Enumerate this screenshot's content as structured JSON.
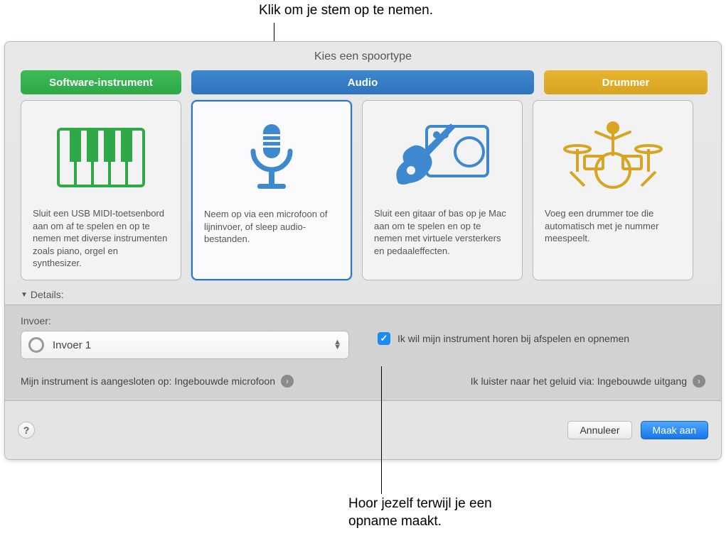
{
  "annotations": {
    "top": "Klik om je stem op te nemen.",
    "bottom": "Hoor jezelf terwijl je een opname maakt."
  },
  "header": {
    "title": "Kies een spoortype"
  },
  "tabs": {
    "software": "Software-instrument",
    "audio": "Audio",
    "drummer": "Drummer"
  },
  "cards": {
    "keyboard": "Sluit een USB MIDI-toetsenbord aan om af te spelen en op te nemen met diverse instrumenten zoals piano, orgel en synthesizer.",
    "mic": "Neem op via een microfoon of lijninvoer, of sleep audio-bestanden.",
    "guitar": "Sluit een gitaar of bas op je Mac aan om te spelen en op te nemen met virtuele versterkers en pedaaleffecten.",
    "drummer": "Voeg een drummer toe die automatisch met je nummer meespeelt."
  },
  "details": {
    "toggle": "Details:",
    "input_label": "Invoer:",
    "input_value": "Invoer 1",
    "monitor_label": "Ik wil mijn instrument horen bij afspelen en opnemen",
    "connected": "Mijn instrument is aangesloten op: Ingebouwde microfoon",
    "listening": "Ik luister naar het geluid via: Ingebouwde uitgang"
  },
  "footer": {
    "cancel": "Annuleer",
    "create": "Maak aan",
    "help": "?"
  },
  "colors": {
    "accent_blue": "#2f73bd",
    "accent_green": "#2fa847",
    "accent_gold": "#d7a423"
  }
}
